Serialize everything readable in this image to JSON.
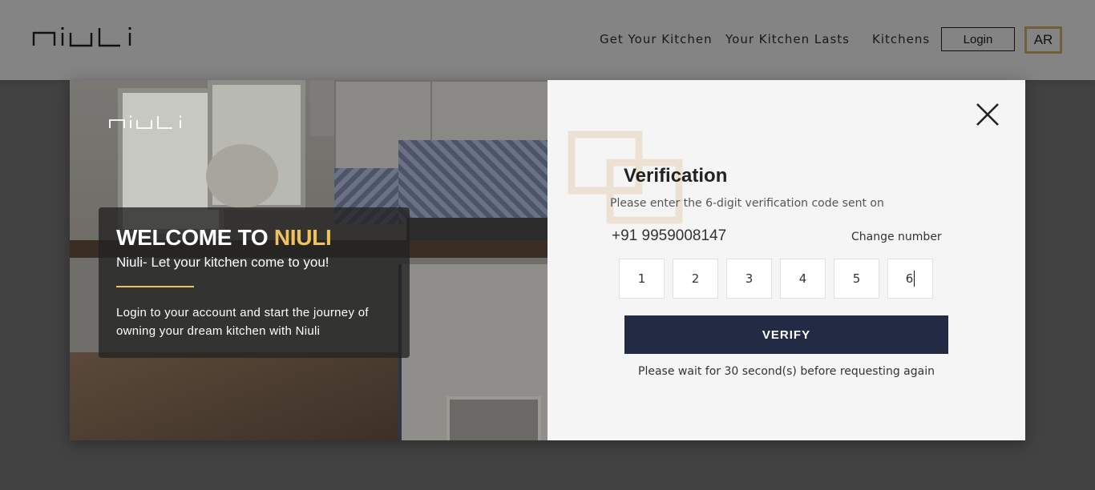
{
  "header": {
    "logo_text": "niuli",
    "nav": [
      "Get Your Kitchen",
      "Your Kitchen Lasts",
      "Kitchens"
    ],
    "login_label": "Login",
    "language_label": "AR"
  },
  "modal": {
    "left": {
      "logo_text": "niuli",
      "welcome_prefix": "WELCOME TO",
      "welcome_brand": "NIULI",
      "tagline": "Niuli- Let your kitchen come to you!",
      "description": "Login to your account and start the journey of owning your dream kitchen with Niuli"
    },
    "right": {
      "title": "Verification",
      "description": "Please enter the 6-digit verification code sent on",
      "phone": "+91 9959008147",
      "change_number_label": "Change number",
      "otp_digits": [
        "1",
        "2",
        "3",
        "4",
        "5",
        "6"
      ],
      "verify_label": "VERIFY",
      "wait_message": "Please wait for 30 second(s) before requesting again"
    }
  },
  "colors": {
    "accent": "#f1c25a",
    "primary_button": "#222a44",
    "ar_border": "#d8b86e"
  },
  "icons": [
    "niuli-logo",
    "close-icon",
    "decorative-squares"
  ]
}
